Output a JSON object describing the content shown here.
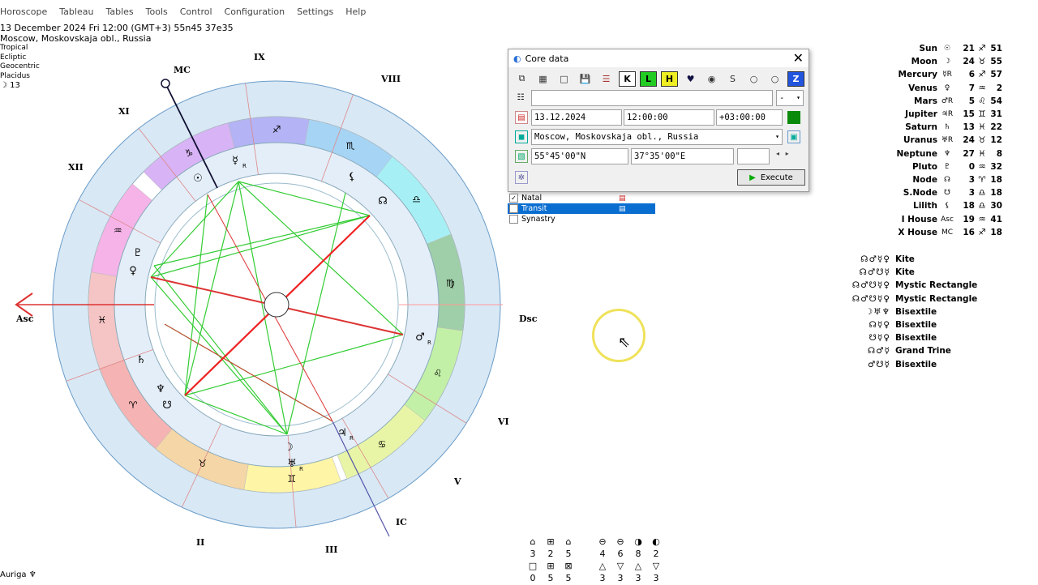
{
  "menu": [
    "Horoscope",
    "Tableau",
    "Tables",
    "Tools",
    "Control",
    "Configuration",
    "Settings",
    "Help"
  ],
  "header": {
    "line1": "13 December 2024  Fri  12:00 (GMT+3) 55n45  37e35",
    "line2": "Moscow, Moskovskaja obl., Russia",
    "small": [
      "Tropical",
      "Ecliptic",
      "Geocentric",
      "Placidus"
    ],
    "moon_day": "☽  13"
  },
  "houses": {
    "mc": "MC",
    "asc": "Asc",
    "dsc": "Dsc",
    "ic": "IC",
    "ix": "IX",
    "viii": "VIII",
    "xi": "XI",
    "xii": "XII",
    "vi": "VI",
    "v": "V",
    "ii": "II",
    "iii": "III"
  },
  "zodiac_glyphs": [
    "♐",
    "♏",
    "♎",
    "♍",
    "♌",
    "♋",
    "♊",
    "♉",
    "♈",
    "♓",
    "♒",
    "♑"
  ],
  "chart_planets": [
    {
      "g": "☿",
      "r": "R"
    },
    {
      "g": "☉",
      "r": ""
    },
    {
      "g": "⚸",
      "r": ""
    },
    {
      "g": "☊",
      "r": ""
    },
    {
      "g": "♀",
      "r": ""
    },
    {
      "g": "♇",
      "r": ""
    },
    {
      "g": "♄",
      "r": ""
    },
    {
      "g": "♆",
      "r": ""
    },
    {
      "g": "☋",
      "r": ""
    },
    {
      "g": "☽",
      "r": ""
    },
    {
      "g": "♅",
      "r": "R"
    },
    {
      "g": "♃",
      "r": "R"
    },
    {
      "g": "♂",
      "r": "R"
    }
  ],
  "planets": [
    {
      "name": "Sun",
      "glyph": "☉",
      "deg": "21",
      "sign": "♐",
      "min": "51"
    },
    {
      "name": "Moon",
      "glyph": "☽",
      "deg": "24",
      "sign": "♉",
      "min": "55"
    },
    {
      "name": "Mercury",
      "glyph": "☿R",
      "deg": "6",
      "sign": "♐",
      "min": "57"
    },
    {
      "name": "Venus",
      "glyph": "♀",
      "deg": "7",
      "sign": "♒",
      "min": "2"
    },
    {
      "name": "Mars",
      "glyph": "♂R",
      "deg": "5",
      "sign": "♌",
      "min": "54"
    },
    {
      "name": "Jupiter",
      "glyph": "♃R",
      "deg": "15",
      "sign": "♊",
      "min": "31"
    },
    {
      "name": "Saturn",
      "glyph": "♄",
      "deg": "13",
      "sign": "♓",
      "min": "22"
    },
    {
      "name": "Uranus",
      "glyph": "♅R",
      "deg": "24",
      "sign": "♉",
      "min": "12"
    },
    {
      "name": "Neptune",
      "glyph": "♆",
      "deg": "27",
      "sign": "♓",
      "min": "8"
    },
    {
      "name": "Pluto",
      "glyph": "♇",
      "deg": "0",
      "sign": "♒",
      "min": "32"
    },
    {
      "name": "Node",
      "glyph": "☊",
      "deg": "3",
      "sign": "♈",
      "min": "18"
    },
    {
      "name": "S.Node",
      "glyph": "☋",
      "deg": "3",
      "sign": "♎",
      "min": "18"
    },
    {
      "name": "Lilith",
      "glyph": "⚸",
      "deg": "18",
      "sign": "♎",
      "min": "30"
    },
    {
      "name": "I House",
      "glyph": "Asc",
      "deg": "19",
      "sign": "♒",
      "min": "41"
    },
    {
      "name": "X House",
      "glyph": "MC",
      "deg": "16",
      "sign": "♐",
      "min": "18"
    }
  ],
  "aspect_patterns": [
    {
      "glyphs": "☊♂☿♀",
      "name": "Kite"
    },
    {
      "glyphs": "☊♂☋☿",
      "name": "Kite"
    },
    {
      "glyphs": "☊♂☋☿♀",
      "name": "Mystic Rectangle"
    },
    {
      "glyphs": "☊♂☋☿♀",
      "name": "Mystic Rectangle"
    },
    {
      "glyphs": "☽♅♆",
      "name": "Bisextile"
    },
    {
      "glyphs": "☊☿♀",
      "name": "Bisextile"
    },
    {
      "glyphs": "☋☿♀",
      "name": "Bisextile"
    },
    {
      "glyphs": "☊♂☿",
      "name": "Grand Trine"
    },
    {
      "glyphs": "♂☋☿",
      "name": "Bisextile"
    }
  ],
  "dialog": {
    "title": "Core data",
    "name_value": "",
    "gender_value": "-",
    "date": "13.12.2024",
    "time": "12:00:00",
    "tz": "+03:00:00",
    "place": "Moscow, Moskovskaja obl., Russia",
    "lat": "55°45'00\"N",
    "lon": "37°35'00\"E",
    "execute": "Execute",
    "toolbar": [
      "⧉",
      "▦",
      "□",
      "💾",
      "☰",
      "K",
      "L",
      "H",
      "♥",
      "◉",
      "S",
      "○",
      "○",
      "Z"
    ]
  },
  "chart_types": [
    {
      "label": "Natal",
      "checked": true
    },
    {
      "label": "Transit",
      "checked": false
    },
    {
      "label": "Synastry",
      "checked": false
    }
  ],
  "bottom": {
    "row1_icons": [
      "⌂",
      "⊞",
      "⌂",
      "",
      "⊖",
      "⊖",
      "◑",
      "◐"
    ],
    "row1_nums": [
      "3",
      "2",
      "5",
      "",
      "4",
      "6",
      "8",
      "2"
    ],
    "row2_icons": [
      "□",
      "⊞",
      "⊠",
      "",
      "△",
      "▽",
      "△",
      "▽"
    ],
    "row2_nums": [
      "0",
      "5",
      "5",
      "",
      "3",
      "3",
      "3",
      "3"
    ]
  },
  "status": "Auriga  ♆"
}
